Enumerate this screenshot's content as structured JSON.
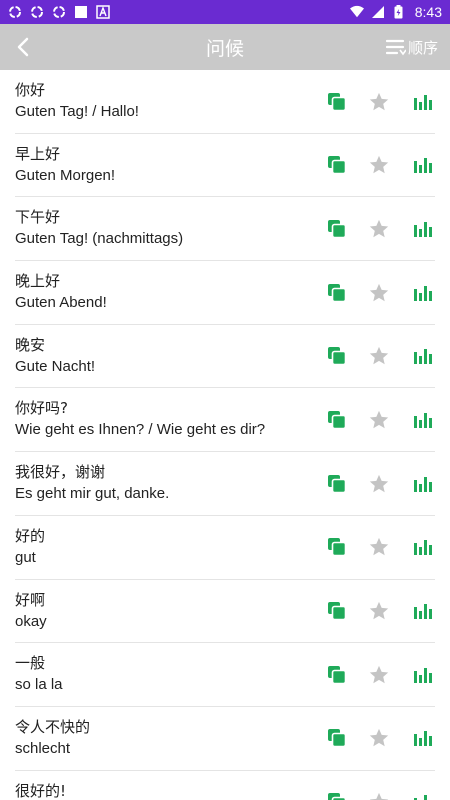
{
  "status_bar": {
    "time": "8:43",
    "icons": [
      "sync-icon",
      "sync-icon",
      "sync-icon",
      "square-icon",
      "a-icon",
      "wifi-icon",
      "signal-icon",
      "battery-icon"
    ]
  },
  "app_bar": {
    "title": "问候",
    "order_label": "顺序"
  },
  "colors": {
    "status_bar": "#6a2bd1",
    "app_bar": "#c9c9c9",
    "accent_green": "#1faa59",
    "star_gray": "#c4c4c4"
  },
  "items": [
    {
      "zh": "你好",
      "de": "Guten Tag! / Hallo!"
    },
    {
      "zh": "早上好",
      "de": "Guten Morgen!"
    },
    {
      "zh": "下午好",
      "de": "Guten Tag! (nachmittags)"
    },
    {
      "zh": "晚上好",
      "de": "Guten Abend!"
    },
    {
      "zh": "晚安",
      "de": "Gute Nacht!"
    },
    {
      "zh": "你好吗?",
      "de": "Wie geht es Ihnen? / Wie geht es dir?"
    },
    {
      "zh": "我很好，谢谢",
      "de": "Es geht mir gut, danke."
    },
    {
      "zh": "好的",
      "de": "gut"
    },
    {
      "zh": "好啊",
      "de": "okay"
    },
    {
      "zh": "一般",
      "de": "so la la"
    },
    {
      "zh": "令人不快的",
      "de": "schlecht"
    },
    {
      "zh": "很好的!",
      "de": ""
    }
  ]
}
